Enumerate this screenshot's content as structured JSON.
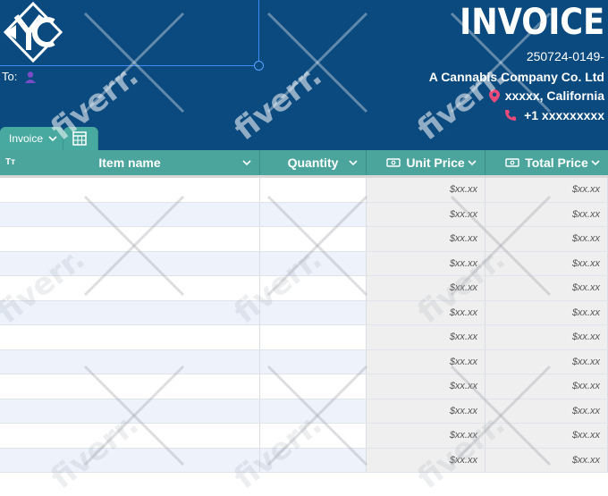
{
  "header": {
    "title": "INVOICE",
    "invoice_number": "250724-0149-",
    "to_label": "To:",
    "company": "A Cannabis Company Co. Ltd",
    "address": "xxxxx, California",
    "phone": "+1 xxxxxxxxx",
    "logo_icon": "yc-logo-icon"
  },
  "tabs": [
    {
      "label": "Invoice",
      "icon": "chevron-down-icon"
    },
    {
      "label": "",
      "icon": "calculator-grid-icon"
    }
  ],
  "columns": [
    {
      "label": "Item name",
      "type_icon": "Tт"
    },
    {
      "label": "Quantity"
    },
    {
      "label": "Unit Price",
      "type_icon": "money-icon"
    },
    {
      "label": "Total Price",
      "type_icon": "money-icon"
    }
  ],
  "price_placeholder": "$xx.xx",
  "row_count": 12,
  "watermark": "fiverr.",
  "colors": {
    "header_bg": "#0b4a7e",
    "teal": "#48a9a0",
    "row_alt": "#edf2fb",
    "price_bg": "#efefef"
  }
}
